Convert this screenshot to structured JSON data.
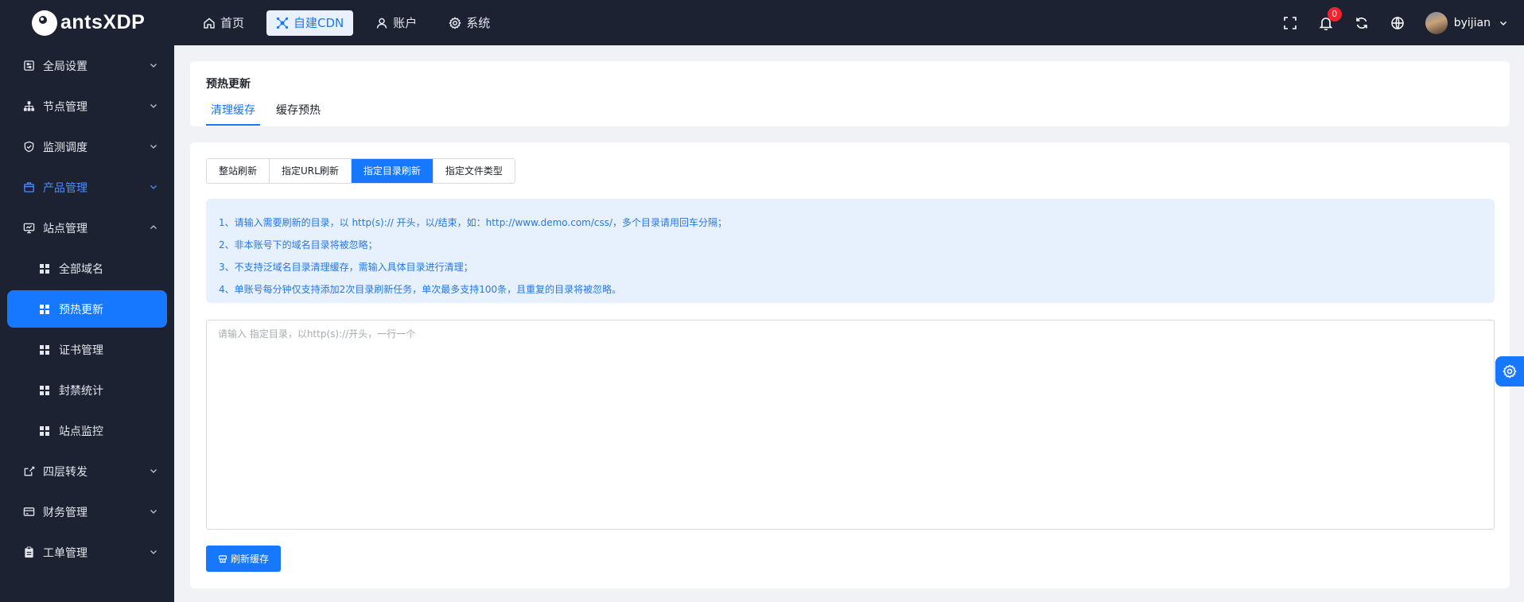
{
  "brand": {
    "name": "antsXDP"
  },
  "topnav": {
    "items": [
      {
        "label": "首页",
        "icon": "home-icon"
      },
      {
        "label": "自建CDN",
        "icon": "network-icon",
        "active": true
      },
      {
        "label": "账户",
        "icon": "user-icon"
      },
      {
        "label": "系统",
        "icon": "gear-icon"
      }
    ]
  },
  "topright": {
    "notification_count": "0",
    "username": "byijian"
  },
  "sidebar": {
    "items": [
      {
        "label": "全局设置",
        "icon": "settings-doc-icon",
        "expanded": false
      },
      {
        "label": "节点管理",
        "icon": "sitemap-icon",
        "expanded": false
      },
      {
        "label": "监测调度",
        "icon": "shield-icon",
        "expanded": false
      },
      {
        "label": "产品管理",
        "icon": "box-icon",
        "expanded": false
      },
      {
        "label": "站点管理",
        "icon": "monitor-icon",
        "expanded": true
      },
      {
        "label": "四层转发",
        "icon": "share-icon",
        "expanded": false
      },
      {
        "label": "财务管理",
        "icon": "card-icon",
        "expanded": false
      },
      {
        "label": "工单管理",
        "icon": "clipboard-icon",
        "expanded": false
      }
    ],
    "site_sub_items": [
      {
        "label": "全部域名"
      },
      {
        "label": "预热更新",
        "active": true
      },
      {
        "label": "证书管理"
      },
      {
        "label": "封禁统计"
      },
      {
        "label": "站点监控"
      }
    ]
  },
  "page": {
    "title": "预热更新",
    "tabs": [
      {
        "label": "清理缓存",
        "active": true
      },
      {
        "label": "缓存预热"
      }
    ],
    "segments": [
      {
        "label": "整站刷新"
      },
      {
        "label": "指定URL刷新"
      },
      {
        "label": "指定目录刷新",
        "active": true
      },
      {
        "label": "指定文件类型"
      }
    ],
    "notice": [
      "1、请输入需要刷新的目录，以 http(s):// 开头，以/结束，如：http://www.demo.com/css/，多个目录请用回车分隔；",
      "2、非本账号下的域名目录将被忽略；",
      "3、不支持泛域名目录清理缓存，需输入具体目录进行清理；",
      "4、单账号每分钟仅支持添加2次目录刷新任务，单次最多支持100条，且重复的目录将被忽略。"
    ],
    "textarea_placeholder": "请输入 指定目录，以http(s)://开头，一行一个",
    "textarea_value": "",
    "submit_label": "刷新缓存"
  },
  "colors": {
    "topbar_bg": "#1c2232",
    "accent": "#1677ff",
    "notice_bg": "#e6f1fd",
    "notice_text": "#2677e8",
    "badge": "#f5222d"
  }
}
